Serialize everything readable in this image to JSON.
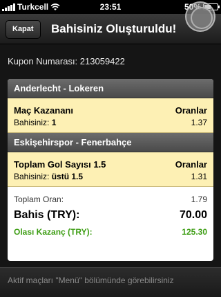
{
  "status_bar": {
    "carrier": "Turkcell",
    "time": "23:51",
    "battery": "50%",
    "battery_level": 0.5,
    "signal_icon": "signal-bars-icon",
    "wifi_icon": "wifi-icon"
  },
  "nav": {
    "close_label": "Kapat",
    "title": "Bahisiniz Oluşturuldu!"
  },
  "coupon": {
    "label": "Kupon Numarası:",
    "number": "213059422"
  },
  "matches": [
    {
      "teams": "Anderlecht - Lokeren",
      "bet_type": "Maç Kazananı",
      "odds_header": "Oranlar",
      "selection_label": "Bahisiniz:",
      "selection": "1",
      "odds": "1.37"
    },
    {
      "teams": "Eskişehirspor - Fenerbahçe",
      "bet_type": "Toplam Gol Sayısı 1.5",
      "odds_header": "Oranlar",
      "selection_label": "Bahisiniz:",
      "selection": "üstü 1.5",
      "odds": "1.31"
    }
  ],
  "summary": {
    "total_odds_label": "Toplam Oran:",
    "total_odds": "1.79",
    "stake_label": "Bahis (TRY):",
    "stake": "70.00",
    "win_label": "Olası Kazanç (TRY):",
    "win": "125.30"
  },
  "footer": {
    "text": "Aktif maçları \"Menü\" bölümünde görebilirsiniz"
  },
  "colors": {
    "bet_background": "#fdf0b4",
    "win_green": "#3f9e16"
  }
}
